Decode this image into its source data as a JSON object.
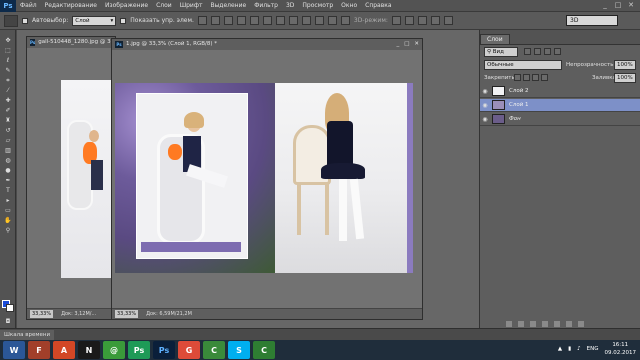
{
  "app": {
    "logo": "Ps"
  },
  "menu": {
    "items": [
      "Файл",
      "Редактирование",
      "Изображение",
      "Слои",
      "Шрифт",
      "Выделение",
      "Фильтр",
      "3D",
      "Просмотр",
      "Окно",
      "Справка"
    ]
  },
  "window_controls": {
    "minimize": "_",
    "maximize": "□",
    "close": "✕"
  },
  "options": {
    "autoselect_label": "Автовыбор:",
    "autoselect_value": "Слой",
    "show_controls_label": "Показать упр. элем.",
    "mode_3d_label": "3D-режим:",
    "workspace": "3D"
  },
  "documents": [
    {
      "title": "gall-510448_1280.jpg @ 33,3%",
      "zoom": "33,33%",
      "doc_info": "Док: 3,12M/..."
    },
    {
      "title": "1.jpg @ 33,3% (Слой 1, RGB/8) *",
      "zoom": "33,33%",
      "doc_info": "Док: 6,59M/21,2M"
    }
  ],
  "layers_panel": {
    "tab": "Слои",
    "filter": "Вид",
    "blend_mode": "Обычные",
    "opacity_label": "Непрозрачность:",
    "opacity_value": "100%",
    "lock_label": "Закрепить:",
    "fill_label": "Заливка:",
    "fill_value": "100%",
    "layers": [
      {
        "name": "Слой 2",
        "visible_icon": "eye-icon"
      },
      {
        "name": "Слой 1",
        "visible_icon": "eye-icon"
      },
      {
        "name": "Фон",
        "visible_icon": "eye-icon"
      }
    ]
  },
  "timeline": {
    "tab": "Шкала времени"
  },
  "taskbar": {
    "apps": [
      "W",
      "F",
      "A",
      "N",
      "@",
      "Ps",
      "G",
      "C",
      "S",
      "C"
    ],
    "lang": "ENG",
    "time": "16:11",
    "date": "09.02.2017"
  },
  "colors": {
    "foreground": "#1a4bd8",
    "background": "#ffffff",
    "selected_layer": "#7d90c8"
  }
}
